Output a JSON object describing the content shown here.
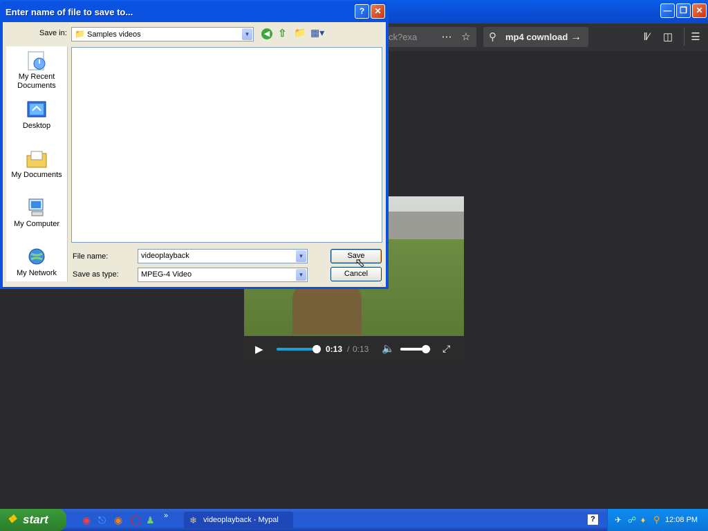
{
  "browser": {
    "url_fragment": "ck?exa",
    "search_text": "mp4 cownload",
    "window_buttons": [
      "minimize",
      "restore",
      "close"
    ]
  },
  "video": {
    "current_time": "0:13",
    "separator": "/",
    "duration": "0:13",
    "progress_fraction": 1.0,
    "volume_fraction": 0.85
  },
  "dialog": {
    "title": "Enter name of file to save to...",
    "save_in_label": "Save in:",
    "save_in_value": "Samples videos",
    "places": [
      {
        "label": "My Recent Documents",
        "icon": "recent-documents-icon"
      },
      {
        "label": "Desktop",
        "icon": "desktop-icon"
      },
      {
        "label": "My Documents",
        "icon": "my-documents-icon"
      },
      {
        "label": "My Computer",
        "icon": "my-computer-icon"
      },
      {
        "label": "My Network",
        "icon": "my-network-icon"
      }
    ],
    "file_name_label": "File name:",
    "file_name_value": "videoplayback",
    "save_as_type_label": "Save as type:",
    "save_as_type_value": "MPEG-4 Video",
    "save_button": "Save",
    "cancel_button": "Cancel"
  },
  "taskbar": {
    "start_label": "start",
    "task_label": "videoplayback - Mypal",
    "clock": "12:08 PM"
  },
  "colors": {
    "xp_blue": "#0b52e0",
    "dialog_bg": "#ece9d8",
    "video_accent": "#19a0d8",
    "start_green": "#3c9a3c"
  }
}
